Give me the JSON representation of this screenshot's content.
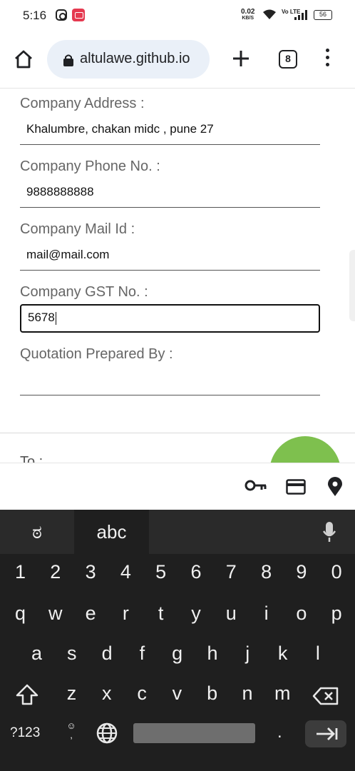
{
  "status_bar": {
    "time": "5:16",
    "net_speed": "0.02",
    "net_unit": "KB/S",
    "volte": "Vo LTE",
    "battery": "56"
  },
  "browser": {
    "url": "altulawe.github.io",
    "tab_count": "8"
  },
  "form": {
    "fields": [
      {
        "label": "Company Address :",
        "value": "Khalumbre, chakan midc , pune 27"
      },
      {
        "label": "Company Phone No. :",
        "value": "9888888888"
      },
      {
        "label": "Company Mail Id :",
        "value": "mail@mail.com"
      },
      {
        "label": "Company GST No. :",
        "value": "5678"
      },
      {
        "label": "Quotation Prepared By :",
        "value": ""
      }
    ],
    "to_label": "To :",
    "fab_color": "#7ec04e"
  },
  "autofill_icons": [
    "key-icon",
    "credit-card-icon",
    "location-pin-icon"
  ],
  "keyboard": {
    "lang_tab": "ಠ",
    "abc_tab": "abc",
    "number_row": [
      "1",
      "2",
      "3",
      "4",
      "5",
      "6",
      "7",
      "8",
      "9",
      "0"
    ],
    "row1": [
      "q",
      "w",
      "e",
      "r",
      "t",
      "y",
      "u",
      "i",
      "o",
      "p"
    ],
    "row2": [
      "a",
      "s",
      "d",
      "f",
      "g",
      "h",
      "j",
      "k",
      "l"
    ],
    "row3": [
      "z",
      "x",
      "c",
      "v",
      "b",
      "n",
      "m"
    ],
    "symbols_key": "?123",
    "emoji_key": "☺ ,",
    "period_key": "."
  }
}
